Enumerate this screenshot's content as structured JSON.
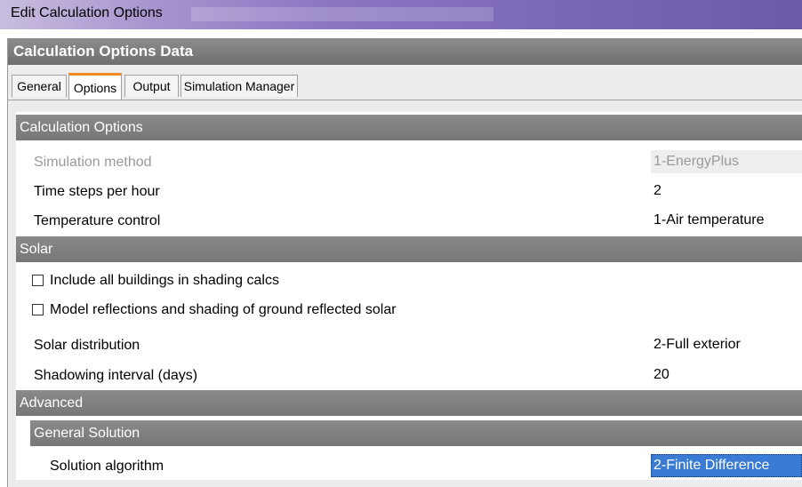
{
  "window": {
    "title": "Edit Calculation Options"
  },
  "panel": {
    "header": "Calculation Options Data"
  },
  "tabs": [
    {
      "label": "General"
    },
    {
      "label": "Options"
    },
    {
      "label": "Output"
    },
    {
      "label": "Simulation Manager"
    }
  ],
  "active_tab": "Options",
  "sections": {
    "calculation_options": {
      "title": "Calculation Options",
      "rows": [
        {
          "label": "Simulation method",
          "value": "1-EnergyPlus",
          "disabled": true
        },
        {
          "label": "Time steps per hour",
          "value": "2"
        },
        {
          "label": "Temperature control",
          "value": "1-Air temperature"
        }
      ]
    },
    "solar": {
      "title": "Solar",
      "checkboxes": [
        {
          "label": "Include all buildings in shading calcs",
          "checked": false
        },
        {
          "label": "Model reflections and shading of ground reflected solar",
          "checked": false
        }
      ],
      "rows": [
        {
          "label": "Solar distribution",
          "value": "2-Full exterior"
        },
        {
          "label": "Shadowing interval (days)",
          "value": "20"
        }
      ]
    },
    "advanced": {
      "title": "Advanced",
      "subsection": {
        "title": "General Solution",
        "rows": [
          {
            "label": "Solution algorithm",
            "value": "2-Finite Difference",
            "selected": true
          }
        ]
      }
    }
  },
  "colors": {
    "title_gradient_start": "#c9bddf",
    "title_gradient_end": "#6c5aa8",
    "section_header": "#7f7f7f",
    "active_tab_accent": "#f08a24",
    "selection": "#3a7bd5"
  }
}
